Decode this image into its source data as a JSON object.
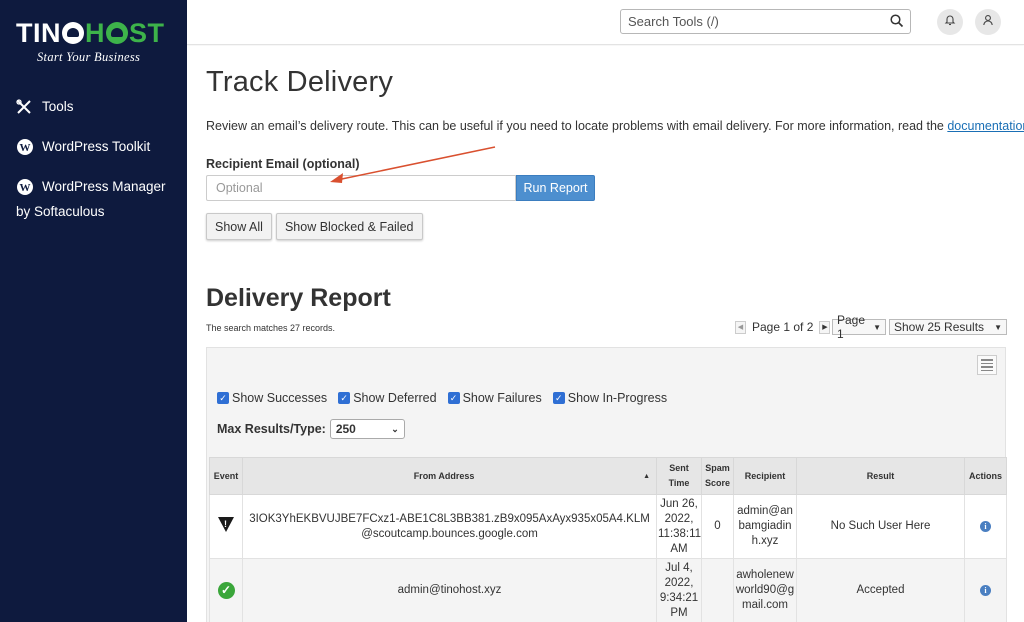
{
  "brand": {
    "logo_part1": "TIN",
    "logo_part2": "H",
    "logo_part3": "ST",
    "tagline": "Start Your Business",
    "color_navy": "#0e1a3e",
    "color_green": "#3db34a"
  },
  "sidebar": {
    "items": [
      {
        "label": "Tools",
        "icon": "tools-icon"
      },
      {
        "label": "WordPress Toolkit",
        "icon": "wordpress-icon"
      },
      {
        "label": "WordPress Manager",
        "label_line2": "by Softaculous",
        "icon": "wordpress-icon"
      }
    ]
  },
  "topbar": {
    "search_placeholder": "Search Tools (/)"
  },
  "page": {
    "title": "Track Delivery",
    "description": "Review an email’s delivery route. This can be useful if you need to locate problems with email delivery. For more information, read the",
    "doc_link": "documentation",
    "period": ".",
    "recipient_label": "Recipient Email (optional)",
    "recipient_placeholder": "Optional",
    "run_report": "Run Report",
    "show_all": "Show All",
    "show_blocked": "Show Blocked & Failed"
  },
  "report": {
    "title": "Delivery Report",
    "match_text": "The search matches 27 records.",
    "pager_text": "Page 1 of 2",
    "page_select": "Page 1",
    "show_select": "Show 25 Results",
    "filters": [
      "Show Successes",
      "Show Deferred",
      "Show Failures",
      "Show In-Progress"
    ],
    "max_results_label": "Max Results/Type:",
    "max_results_value": "250",
    "columns": [
      "Event",
      "From Address",
      "Sent Time",
      "Spam Score",
      "Recipient",
      "Result",
      "Actions"
    ],
    "rows": [
      {
        "event": "warning",
        "from": "3IOK3YhEKBVUJBE7FCxz1-ABE1C8L3BB381.zB9x095AxAyx935x05A4.KLM@scoutcamp.bounces.google.com",
        "sent": "Jun 26, 2022, 11:38:11 AM",
        "spam": "0",
        "recipient": "admin@anbamgiadinh.xyz",
        "result": "No Such User Here"
      },
      {
        "event": "success",
        "from": "admin@tinohost.xyz",
        "sent": "Jul 4, 2022, 9:34:21 PM",
        "spam": "",
        "recipient": "awholenewworld90@gmail.com",
        "result": "Accepted"
      }
    ]
  }
}
